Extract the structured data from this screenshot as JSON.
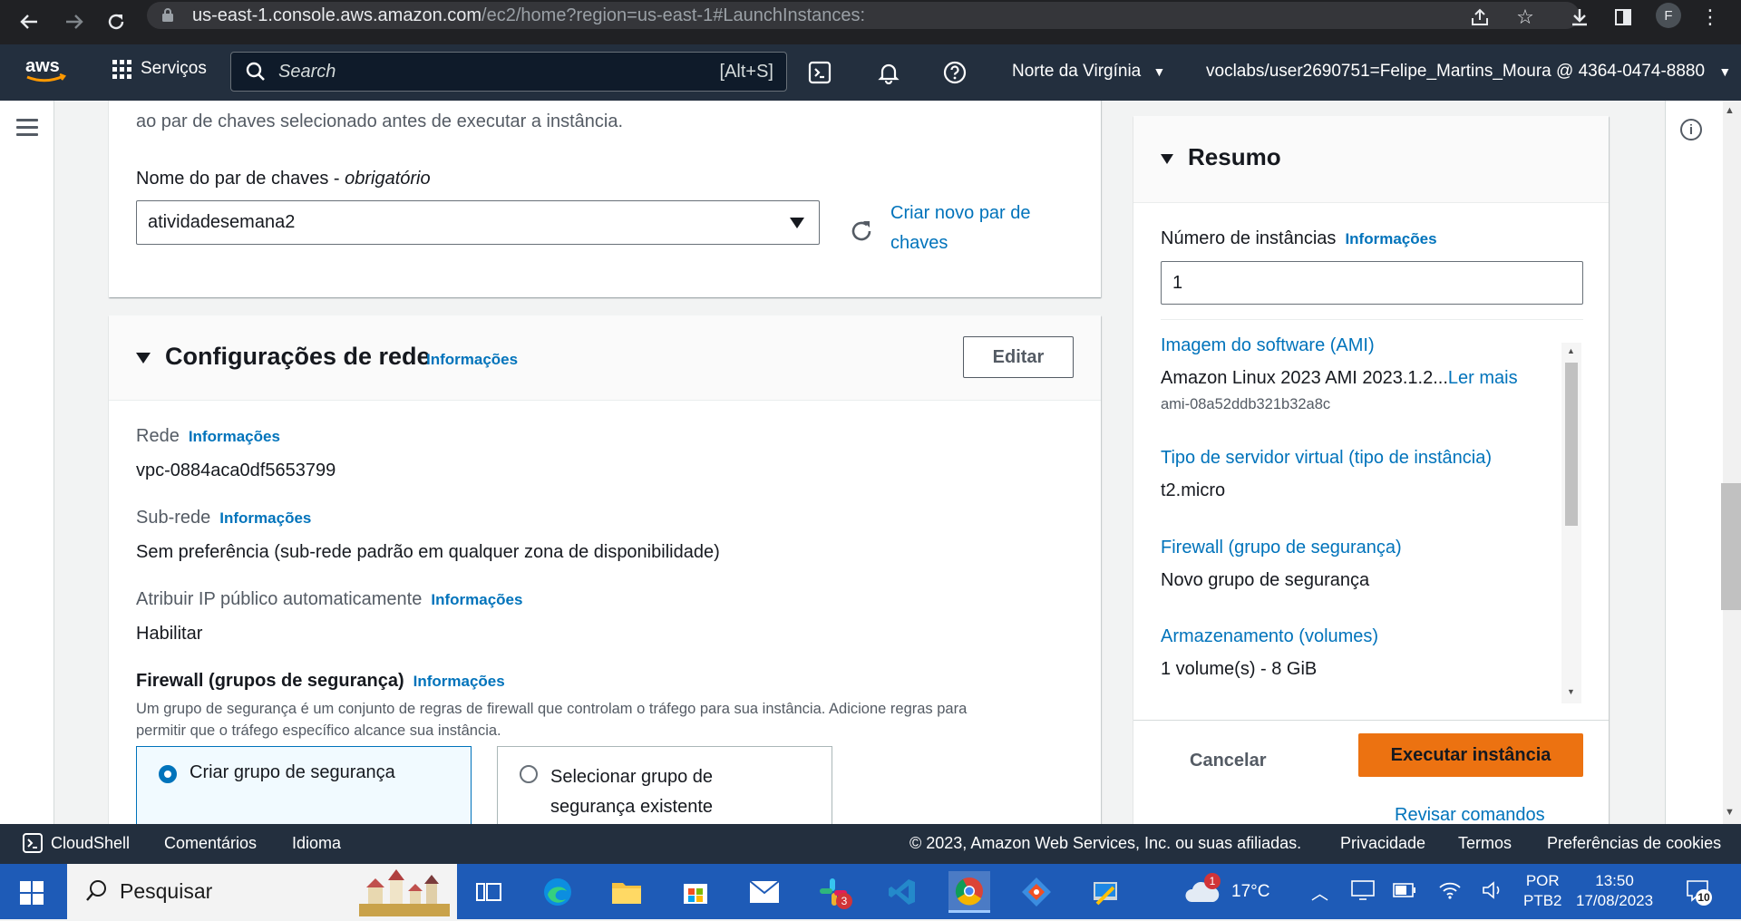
{
  "browser": {
    "url_main": "us-east-1.console.aws.amazon.com",
    "url_path": "/ec2/home?region=us-east-1#LaunchInstances:",
    "profile_initial": "F"
  },
  "aws_nav": {
    "services_label": "Serviços",
    "search_placeholder": "Search",
    "search_shortcut": "[Alt+S]",
    "region": "Norte da Virgínia",
    "account": "voclabs/user2690751=Felipe_Martins_Moura @ 4364-0474-8880"
  },
  "keypair": {
    "description": "ao par de chaves selecionado antes de executar a instância.",
    "label": "Nome do par de chaves - ",
    "label_required": "obrigatório",
    "selected": "atividadesemana2",
    "create_link_line1": "Criar novo par de",
    "create_link_line2": "chaves"
  },
  "network": {
    "title": "Configurações de rede",
    "info": "Informações",
    "edit_label": "Editar",
    "network_label": "Rede",
    "network_value": "vpc-0884aca0df5653799",
    "subnet_label": "Sub-rede",
    "subnet_value": "Sem preferência (sub-rede padrão em qualquer zona de disponibilidade)",
    "public_ip_label": "Atribuir IP público automaticamente",
    "public_ip_value": "Habilitar",
    "firewall_label": "Firewall (grupos de segurança)",
    "firewall_desc_line1": "Um grupo de segurança é um conjunto de regras de firewall que controlam o tráfego para sua instância. Adicione regras para",
    "firewall_desc_line2": "permitir que o tráfego específico alcance sua instância.",
    "option_create": "Criar grupo de segurança",
    "option_select_line1": "Selecionar grupo de",
    "option_select_line2": "segurança existente"
  },
  "summary": {
    "title": "Resumo",
    "instances_label": "Número de instâncias",
    "info": "Informações",
    "instances_value": "1",
    "ami_label": "Imagem do software (AMI)",
    "ami_value": "Amazon Linux 2023 AMI 2023.1.2...",
    "ami_read_more": "Ler mais",
    "ami_id": "ami-08a52ddb321b32a8c",
    "type_label": "Tipo de servidor virtual (tipo de instância)",
    "type_value": "t2.micro",
    "firewall_label": "Firewall (grupo de segurança)",
    "firewall_value": "Novo grupo de segurança",
    "storage_label": "Armazenamento (volumes)",
    "storage_value": "1 volume(s) - 8 GiB",
    "cancel_label": "Cancelar",
    "launch_label": "Executar instância",
    "review_label": "Revisar comandos"
  },
  "footer": {
    "cloudshell": "CloudShell",
    "feedback": "Comentários",
    "language": "Idioma",
    "copyright": "© 2023, Amazon Web Services, Inc. ou suas afiliadas.",
    "privacy": "Privacidade",
    "terms": "Termos",
    "cookies": "Preferências de cookies"
  },
  "taskbar": {
    "search_placeholder": "Pesquisar",
    "weather_temp": "17°C",
    "weather_badge": "1",
    "lang_line1": "POR",
    "lang_line2": "PTB2",
    "time": "13:50",
    "date": "17/08/2023",
    "notif_count": "10",
    "slack_badge": "3"
  },
  "colors": {
    "aws_nav": "#232f3e",
    "link": "#0073bb",
    "launch_button": "#ec7211",
    "taskbar": "#1e5bb7"
  }
}
